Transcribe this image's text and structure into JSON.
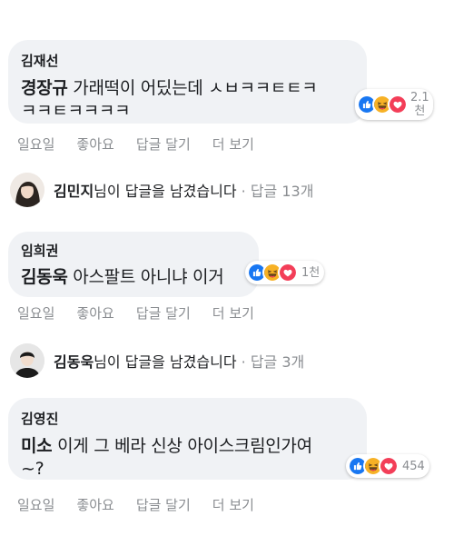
{
  "comments": [
    {
      "author": "김재선",
      "mention": "경장규",
      "text_line1": "가래떡이 어딨는데 ㅅㅂㅋㅋㅌㅌㅋ",
      "text_line2": "ㅋㅋㅌㅋㅋㅋㅋ",
      "reaction_count_line1": "2.1",
      "reaction_count_line2": "천"
    },
    {
      "author": "임희권",
      "mention": "김동욱",
      "text_line1": "아스팔트 아니냐 이거",
      "reaction_count": "1천"
    },
    {
      "author": "김영진",
      "mention": "미소",
      "text_line1": "이게 그 베라 신상 아이스크림인가여",
      "text_line2": "~?",
      "reaction_count": "454"
    }
  ],
  "actions": {
    "day": "일요일",
    "like": "좋아요",
    "reply": "답글 달기",
    "more": "더 보기"
  },
  "replies": [
    {
      "name": "김민지",
      "suffix": "님이 답글을 남겼습니다",
      "meta": "· 답글 13개"
    },
    {
      "name": "김동욱",
      "suffix": "님이 답글을 남겼습니다",
      "meta": "· 답글 3개"
    }
  ],
  "colors": {
    "bubble": "#f0f2f5",
    "like": "#1877f2",
    "haha": "#f7b125",
    "love": "#f33e58",
    "muted": "#8a8d91"
  },
  "icons": [
    "like-reaction-icon",
    "haha-reaction-icon",
    "love-reaction-icon",
    "reply-arrow-icon"
  ]
}
